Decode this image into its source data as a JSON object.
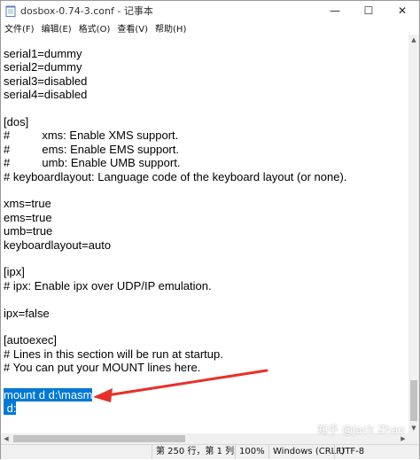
{
  "window": {
    "title": "dosbox-0.74-3.conf - 记事本",
    "controls": {
      "minimize": "—",
      "maximize": "☐",
      "close": "✕"
    }
  },
  "menu": [
    {
      "label": "文件(F)"
    },
    {
      "label": "编辑(E)"
    },
    {
      "label": "格式(O)"
    },
    {
      "label": "查看(V)"
    },
    {
      "label": "帮助(H)"
    }
  ],
  "lines": [
    "serial1=dummy",
    "serial2=dummy",
    "serial3=disabled",
    "serial4=disabled",
    "",
    "[dos]",
    "#          xms: Enable XMS support.",
    "#          ems: Enable EMS support.",
    "#          umb: Enable UMB support.",
    "# keyboardlayout: Language code of the keyboard layout (or none).",
    "",
    "xms=true",
    "ems=true",
    "umb=true",
    "keyboardlayout=auto",
    "",
    "[ipx]",
    "# ipx: Enable ipx over UDP/IP emulation.",
    "",
    "ipx=false",
    "",
    "[autoexec]",
    "# Lines in this section will be run at startup.",
    "# You can put your MOUNT lines here.",
    "",
    "mount d d:\\masm",
    " d:"
  ],
  "selected_lines": [
    25,
    26
  ],
  "status": {
    "position": "第 250 行，第 1 列",
    "zoom": "100%",
    "eol": "Windows (CRLF)",
    "encoding": "UTF-8"
  },
  "watermark": "知乎 @Jack Zhao",
  "colors": {
    "selection": "#0078d7",
    "annotation_arrow": "#e8302a"
  }
}
